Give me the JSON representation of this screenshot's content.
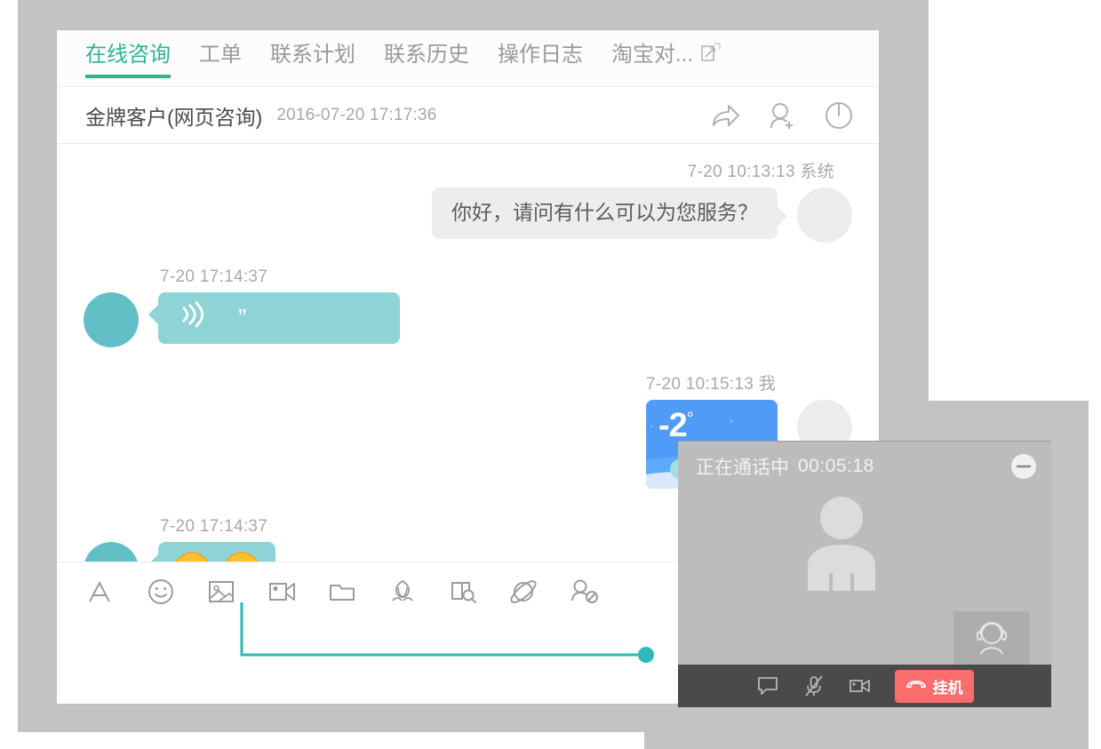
{
  "colors": {
    "accent_teal": "#2fb592",
    "bubble_teal": "#8ed3d6",
    "avatar_teal": "#63bfc6",
    "backdrop_grey": "#c3c3c3",
    "hangup_red": "#fb6d6d",
    "weather_blue": "#4f9bf6",
    "annotation_teal": "#2eb8b8"
  },
  "tabs": [
    {
      "label": "在线咨询",
      "active": true
    },
    {
      "label": "工单",
      "active": false
    },
    {
      "label": "联系计划",
      "active": false
    },
    {
      "label": "联系历史",
      "active": false
    },
    {
      "label": "操作日志",
      "active": false
    },
    {
      "label": "淘宝对...",
      "active": false,
      "icon": "popout-icon"
    }
  ],
  "contact": {
    "name": "金牌客户(网页咨询)",
    "time": "2016-07-20 17:17:36",
    "actions": [
      {
        "name": "forward-icon"
      },
      {
        "name": "add-user-icon"
      },
      {
        "name": "power-icon"
      }
    ]
  },
  "messages": [
    {
      "side": "right",
      "meta": "7-20  10:13:13  系统",
      "type": "text",
      "text": "你好，请问有什么可以为您服务？"
    },
    {
      "side": "left",
      "meta": "7-20  17:14:37",
      "type": "voice",
      "quote": "”"
    },
    {
      "side": "right",
      "meta": "7-20  10:15:13  我",
      "type": "image",
      "temperature": "-2",
      "degree": "°"
    },
    {
      "side": "left",
      "meta": "7-20  17:14:37",
      "type": "emoji",
      "emojis": [
        "grinning-face",
        "grinning-face"
      ]
    }
  ],
  "toolbar": [
    {
      "name": "font-icon"
    },
    {
      "name": "emoji-icon"
    },
    {
      "name": "image-icon"
    },
    {
      "name": "video-camera-icon"
    },
    {
      "name": "folder-icon"
    },
    {
      "name": "flower-icon"
    },
    {
      "name": "book-search-icon"
    },
    {
      "name": "planet-icon"
    },
    {
      "name": "block-user-icon"
    }
  ],
  "call": {
    "status": "正在通话中",
    "timer": "00:05:18",
    "minimize": "minimize-icon",
    "controls": [
      {
        "name": "chat-bubble-icon"
      },
      {
        "name": "mic-muted-icon"
      },
      {
        "name": "video-camera-icon"
      }
    ],
    "hangup_label": "挂机"
  }
}
